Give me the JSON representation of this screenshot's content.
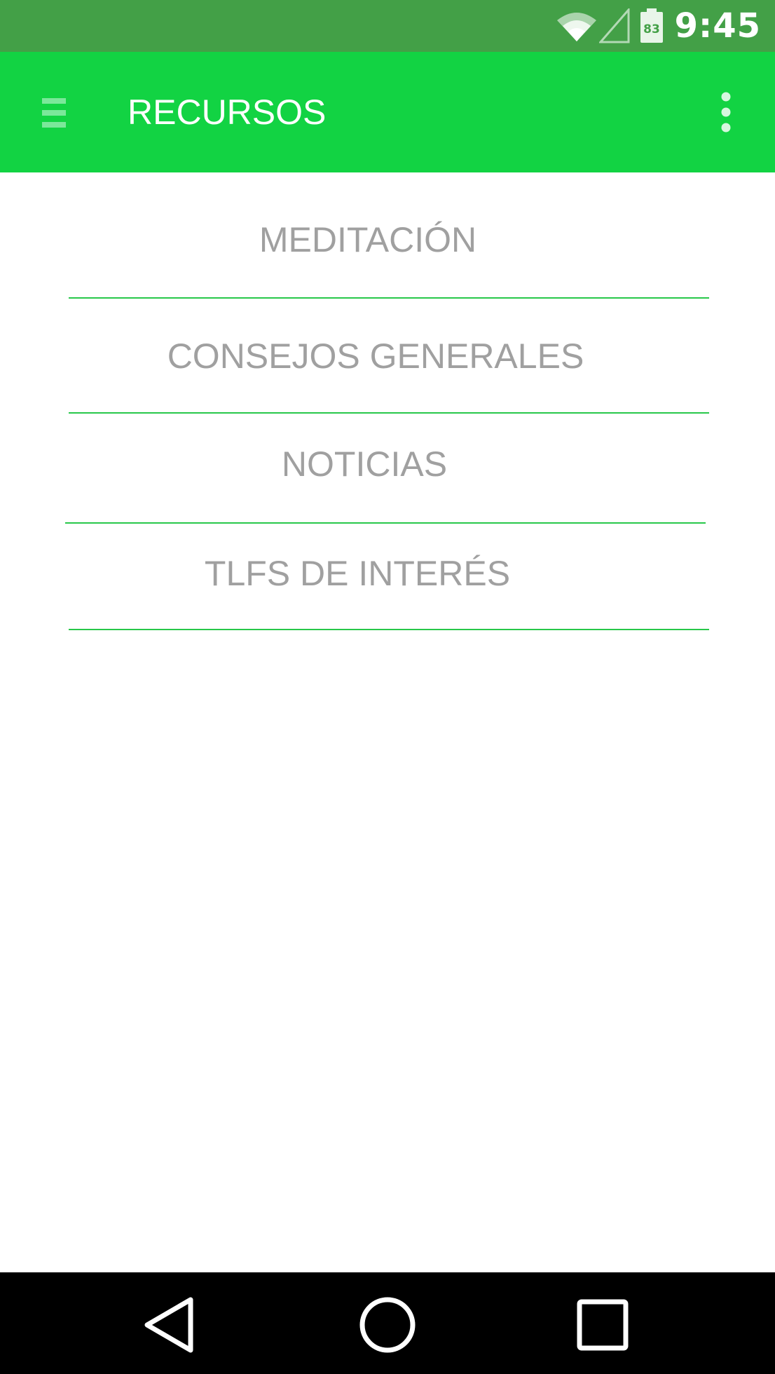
{
  "status_bar": {
    "time": "9:45",
    "battery_level": "83",
    "icons": [
      "wifi-icon",
      "cell-signal-icon",
      "battery-icon"
    ]
  },
  "app_bar": {
    "title": "RECURSOS",
    "menu_icon": "hamburger-menu-icon",
    "overflow_icon": "more-vert-icon"
  },
  "resources": {
    "items": [
      {
        "label": "MEDITACIÓN"
      },
      {
        "label": "CONSEJOS GENERALES"
      },
      {
        "label": "NOTICIAS"
      },
      {
        "label": "TLFS DE INTERÉS"
      }
    ]
  },
  "nav_bar": {
    "buttons": [
      "back-icon",
      "home-icon",
      "recents-icon"
    ]
  },
  "colors": {
    "status_bar": "#43a047",
    "app_bar": "#12d343",
    "divider": "#28c84a",
    "item_text": "#a0a0a0",
    "nav_bar": "#000000"
  }
}
